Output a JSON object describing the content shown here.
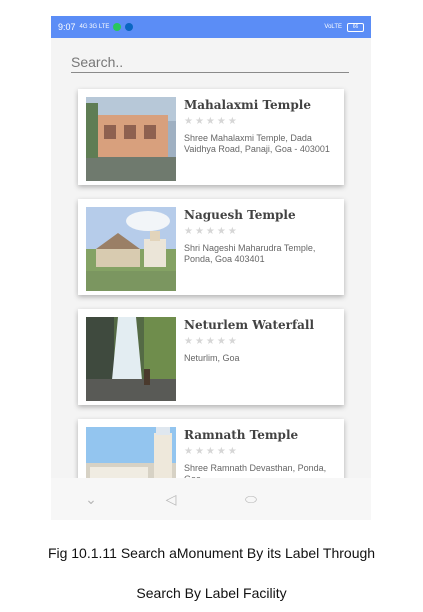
{
  "status": {
    "time": "9:07",
    "network_left": "4G 3G LTE",
    "network_right": "VoLTE",
    "battery": "66"
  },
  "search": {
    "placeholder": "Search.."
  },
  "places": [
    {
      "name": "Mahalaxmi Temple",
      "rating": "★★★★★",
      "address": "Shree Mahalaxmi Temple, Dada Vaidhya Road, Panaji, Goa - 403001"
    },
    {
      "name": "Naguesh Temple",
      "rating": "★★★★★",
      "address": "Shri Nageshi Maharudra Temple, Ponda, Goa 403401"
    },
    {
      "name": "Neturlem Waterfall",
      "rating": "★★★★★",
      "address": "Neturlim, Goa"
    },
    {
      "name": "Ramnath Temple",
      "rating": "★★★★★",
      "address": "Shree Ramnath Devasthan, Ponda, Goa"
    }
  ],
  "nav": {
    "down": "⌄",
    "back": "◁",
    "home": "⬭"
  },
  "caption": {
    "line1": "Fig 10.1.11 Search aMonument By its Label Through",
    "line2": "Search By Label Facility"
  },
  "colors": {
    "status_bar": "#5b8df6",
    "card_bg": "#ffffff",
    "star_empty": "#d6d6d6"
  },
  "icons": [
    "wifi-icon",
    "signal-icon",
    "whatsapp-icon",
    "linkedin-icon",
    "battery-icon"
  ]
}
